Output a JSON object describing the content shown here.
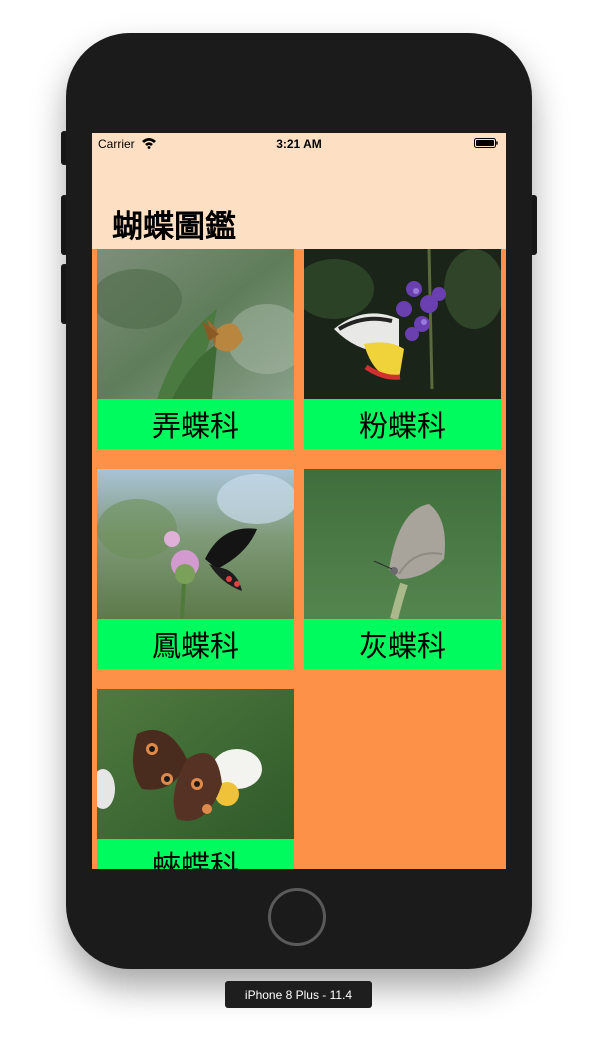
{
  "device": {
    "label": "iPhone 8 Plus - 11.4"
  },
  "statusbar": {
    "carrier": "Carrier",
    "time": "3:21 AM",
    "wifi_icon": "wifi-icon",
    "battery_icon": "battery-icon"
  },
  "navigation": {
    "title": "蝴蝶圖鑑"
  },
  "colors": {
    "navbar_bg": "#fde0c3",
    "grid_bg": "#fd9147",
    "label_bg": "#00fb5e"
  },
  "items": [
    {
      "label": "弄蝶科",
      "icon": "skipper-butterfly-photo"
    },
    {
      "label": "粉蝶科",
      "icon": "pierid-butterfly-photo"
    },
    {
      "label": "鳳蝶科",
      "icon": "swallowtail-butterfly-photo"
    },
    {
      "label": "灰蝶科",
      "icon": "lycaenid-butterfly-photo"
    },
    {
      "label": "蛺蝶科",
      "icon": "nymphalid-butterfly-photo"
    }
  ]
}
